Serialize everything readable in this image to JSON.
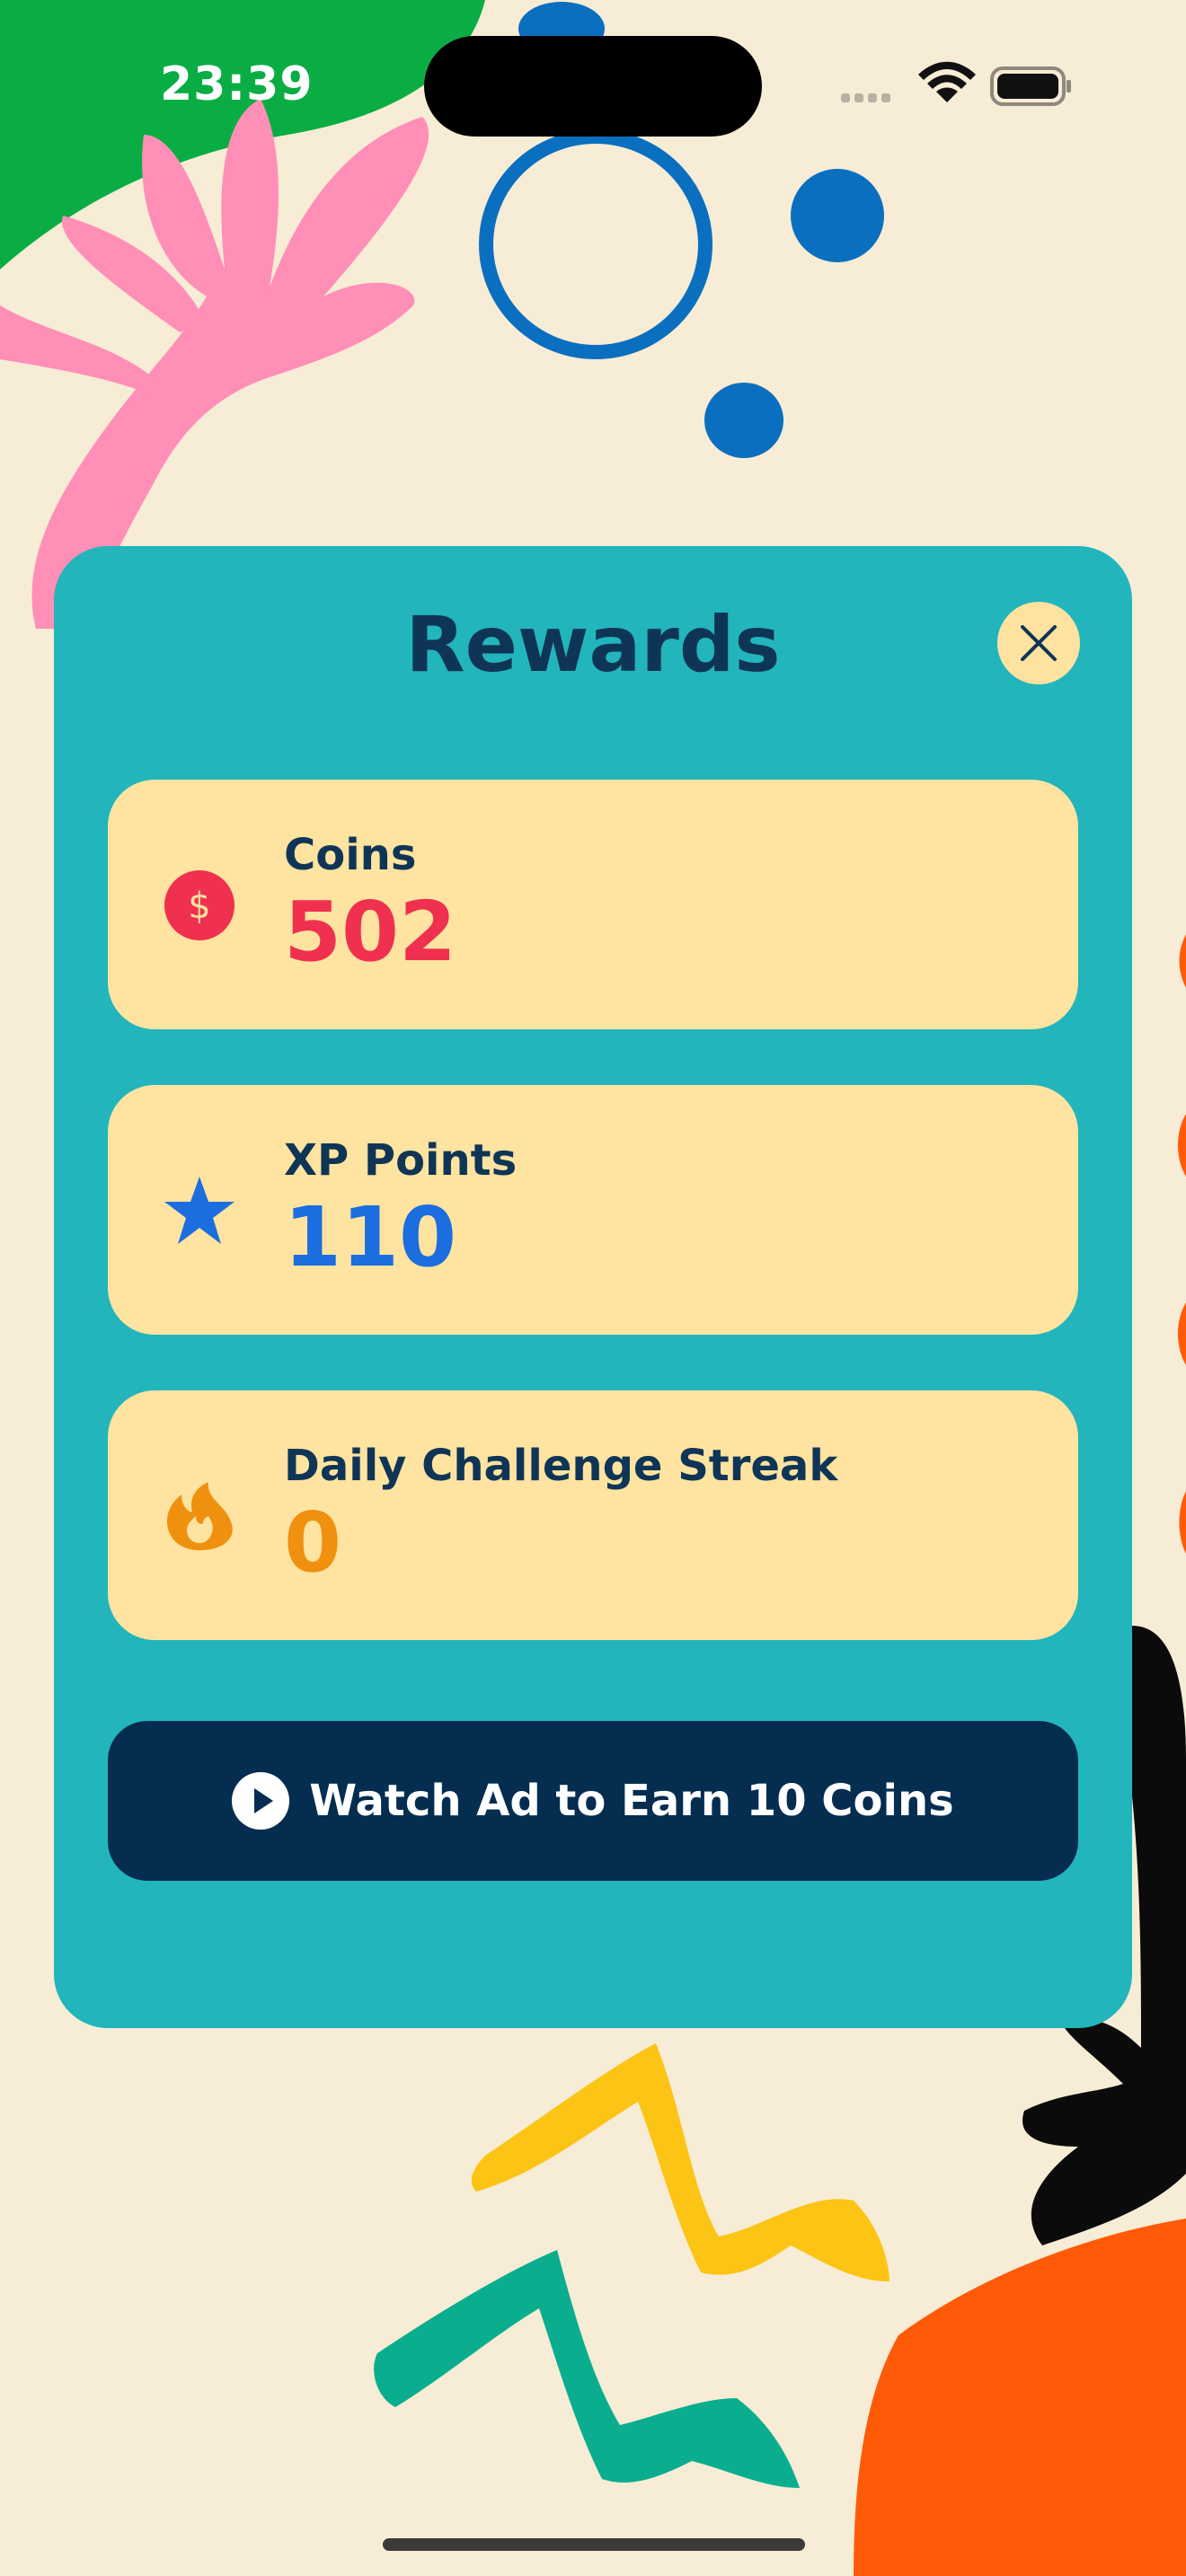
{
  "status_bar": {
    "time": "23:39"
  },
  "rewards": {
    "title": "Rewards",
    "stats": [
      {
        "label": "Coins",
        "value": "502",
        "icon": "dollar-coin-icon",
        "color": "#f0304f"
      },
      {
        "label": "XP Points",
        "value": "110",
        "icon": "star-icon",
        "color": "#1b6de0"
      },
      {
        "label": "Daily Challenge Streak",
        "value": "0",
        "icon": "flame-icon",
        "color": "#f0900f"
      }
    ],
    "watch_ad_label": "Watch Ad to Earn 10 Coins"
  },
  "colors": {
    "background": "#f7ecd6",
    "panel": "#22b5bc",
    "stat_card": "#ffe3a0",
    "heading": "#0f3556",
    "ad_button": "#042d50"
  }
}
